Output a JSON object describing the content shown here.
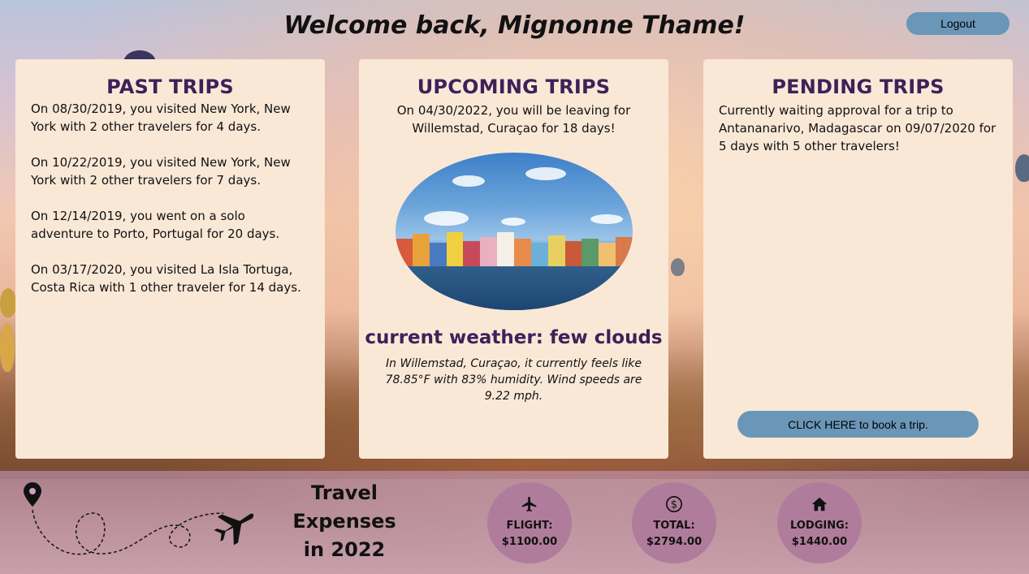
{
  "header": {
    "welcome": "Welcome back, Mignonne Thame!",
    "logout_label": "Logout"
  },
  "past_trips": {
    "title": "PAST TRIPS",
    "items": [
      "On 08/30/2019, you visited New York, New York with 2 other travelers for 4 days.",
      "On 10/22/2019, you visited New York, New York with 2 other travelers for 7 days.",
      "On 12/14/2019, you went on a solo adventure to Porto, Portugal for 20 days.",
      "On 03/17/2020, you visited La Isla Tortuga, Costa Rica with 1 other traveler for 14 days."
    ]
  },
  "upcoming_trips": {
    "title": "UPCOMING TRIPS",
    "text": "On 04/30/2022, you will be leaving for Willemstad, Curaçao for 18 days!",
    "weather_title": "current weather: few clouds",
    "weather_description": "In Willemstad, Curaçao, it currently feels like 78.85°F with 83% humidity. Wind speeds are 9.22 mph."
  },
  "pending_trips": {
    "title": "PENDING TRIPS",
    "text": "Currently waiting approval for a trip to Antananarivo, Madagascar on 09/07/2020 for 5 days with 5 other travelers!",
    "book_label": "CLICK HERE to book a trip."
  },
  "expenses": {
    "title": "Travel Expenses in 2022",
    "flight": {
      "label": "FLIGHT:",
      "value": "$1100.00",
      "icon": "airplane-icon"
    },
    "total": {
      "label": "TOTAL:",
      "value": "$2794.00",
      "icon": "dollar-icon"
    },
    "lodging": {
      "label": "LODGING:",
      "value": "$1440.00",
      "icon": "house-icon"
    }
  },
  "colors": {
    "accent_title": "#3d2159",
    "button": "#6a97b8",
    "card_bg": "#fae8d6",
    "circle": "#b07c9c"
  }
}
